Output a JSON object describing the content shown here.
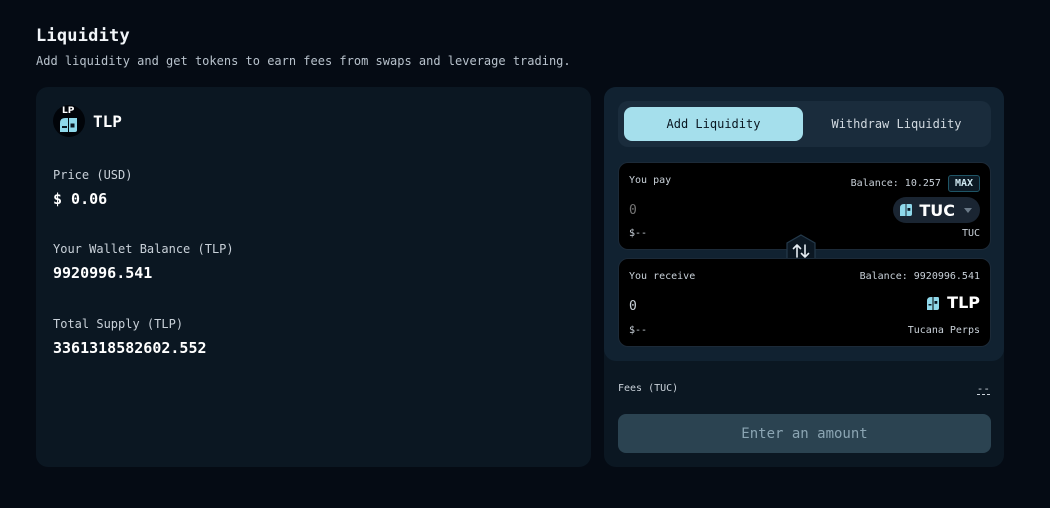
{
  "page": {
    "title": "Liquidity",
    "subtitle": "Add liquidity and get tokens to earn fees from swaps and leverage trading."
  },
  "pool": {
    "badge": "LP",
    "token": "TLP",
    "price_label": "Price (USD)",
    "price_value": "$ 0.06",
    "wallet_label": "Your Wallet Balance (TLP)",
    "wallet_value": "9920996.541",
    "supply_label": "Total Supply (TLP)",
    "supply_value": "3361318582602.552"
  },
  "tabs": {
    "add": "Add Liquidity",
    "withdraw": "Withdraw Liquidity",
    "active": "add"
  },
  "pay": {
    "label": "You pay",
    "balance": "Balance: 10.257",
    "max": "MAX",
    "amount_placeholder": "0",
    "usd": "$--",
    "token": "TUC",
    "token_sub": "TUC"
  },
  "receive": {
    "label": "You receive",
    "balance": "Balance: 9920996.541",
    "amount": "0",
    "usd": "$--",
    "token": "TLP",
    "token_sub": "Tucana Perps"
  },
  "fees": {
    "label": "Fees (TUC)",
    "value": "--"
  },
  "submit_label": "Enter an amount",
  "colors": {
    "background": "#050b14",
    "card": "#0b1722",
    "accent": "#a5dfec",
    "button_disabled": "#2b4351"
  },
  "icons": {
    "pool": "lp-token-icon",
    "pay_token": "tuc-token-icon",
    "receive_token": "tlp-token-icon",
    "swap": "swap-arrows-icon",
    "dropdown": "chevron-down-icon"
  }
}
